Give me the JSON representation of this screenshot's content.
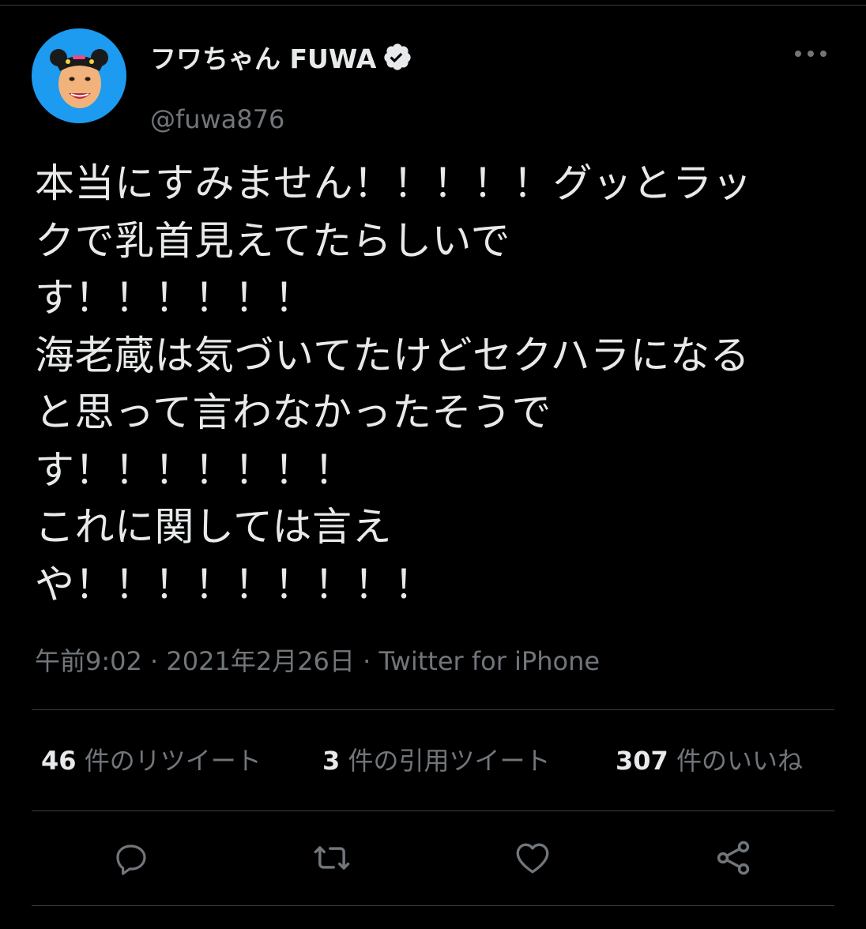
{
  "author": {
    "display_name": "フワちゃん FUWA",
    "handle": "@fuwa876",
    "verified_icon": "verified-badge-icon",
    "avatar_bg": "#1d9bf0"
  },
  "tweet": {
    "lines": [
      "本当にすみません！！！！！グッとラッ",
      "クで乳首見えてたらしいで",
      "す！！！！！！",
      "海老蔵は気づいてたけどセクハラになる",
      "と思って言わなかったそうで",
      "す！！！！！！！",
      "これに関しては言え",
      "や！！！！！！！！！"
    ]
  },
  "meta": {
    "time": "午前9:02",
    "separator": " · ",
    "date": "2021年2月26日",
    "source": "Twitter for iPhone"
  },
  "stats": {
    "retweets_count": "46",
    "retweets_label": " 件のリツイート",
    "quotes_count": "3",
    "quotes_label": " 件の引用ツイート",
    "likes_count": "307",
    "likes_label": " 件のいいね"
  },
  "actions": {
    "reply_icon": "reply-icon",
    "retweet_icon": "retweet-icon",
    "like_icon": "heart-icon",
    "share_icon": "share-icon"
  },
  "colors": {
    "background": "#000000",
    "text": "#e7e9ea",
    "secondary": "#71767b",
    "accent": "#1d9bf0"
  }
}
